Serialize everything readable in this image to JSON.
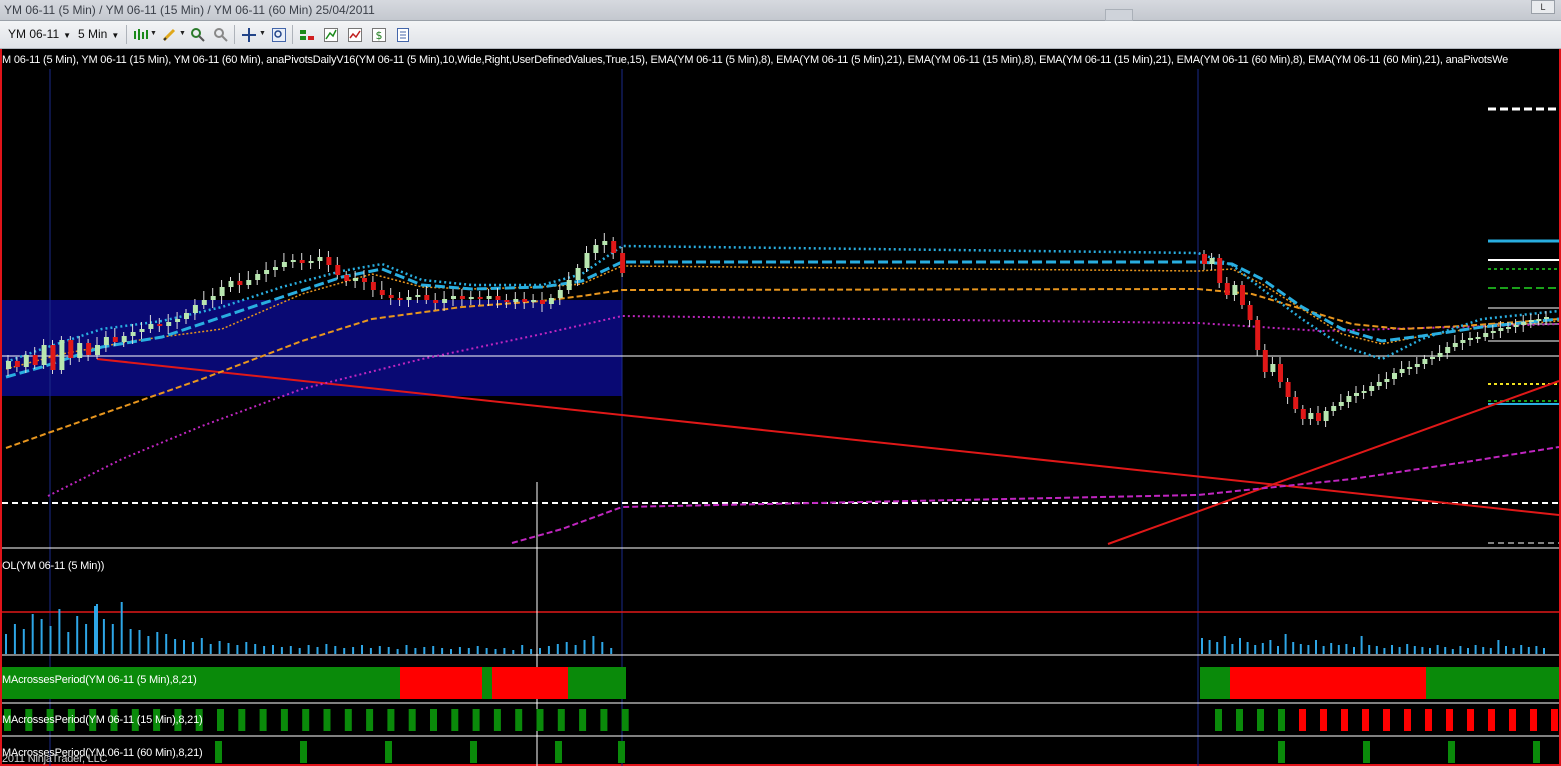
{
  "window": {
    "title": "YM 06-11 (5 Min) / YM 06-11 (15 Min) / YM 06-11 (60 Min)  25/04/2011",
    "restore_label": "L"
  },
  "toolbar": {
    "instrument": "YM 06-11",
    "period": "5 Min",
    "icons": [
      "bar-type-icon",
      "drawing-pencil-icon",
      "zoom-in-icon",
      "zoom-out-icon",
      "crosshair-icon",
      "zoom-box-icon",
      "chart-trader-icon",
      "strategies-icon",
      "indicators-icon",
      "dollar-icon",
      "properties-icon"
    ]
  },
  "panels": {
    "price_header": "M 06-11 (5 Min), YM 06-11 (15 Min), YM 06-11 (60 Min), anaPivotsDailyV16(YM 06-11 (5 Min),10,Wide,Right,UserDefinedValues,True,15), EMA(YM 06-11 (5 Min),8), EMA(YM 06-11 (5 Min),21), EMA(YM 06-11 (15 Min),8), EMA(YM 06-11 (15 Min),21), EMA(YM 06-11 (60 Min),8), EMA(YM 06-11 (60 Min),21), anaPivotsWe",
    "volume_label": "OL(YM 06-11 (5 Min))",
    "ma5_label": "MAcrossesPeriod(YM 06-11 (5 Min),8,21)",
    "ma15_label": "MAcrossesPeriod(YM 06-11 (15 Min),8,21)",
    "ma60_label": "MAcrossesPeriod(YM 06-11 (60 Min),8,21)",
    "copyright": "2011 NinjaTrader, LLC"
  },
  "colors": {
    "bull_candle": "#b8e6b0",
    "bear_candle": "#e01818",
    "ema_fast_5": "#29aee0",
    "ema_orange": "#e8961e",
    "ema_magenta": "#c026c0",
    "trendline": "#e01818",
    "session_box": "#0a0a80",
    "ma_bull": "#0a8a0a",
    "ma_bear": "#ff0000",
    "volume": "#2ea6e6"
  }
}
